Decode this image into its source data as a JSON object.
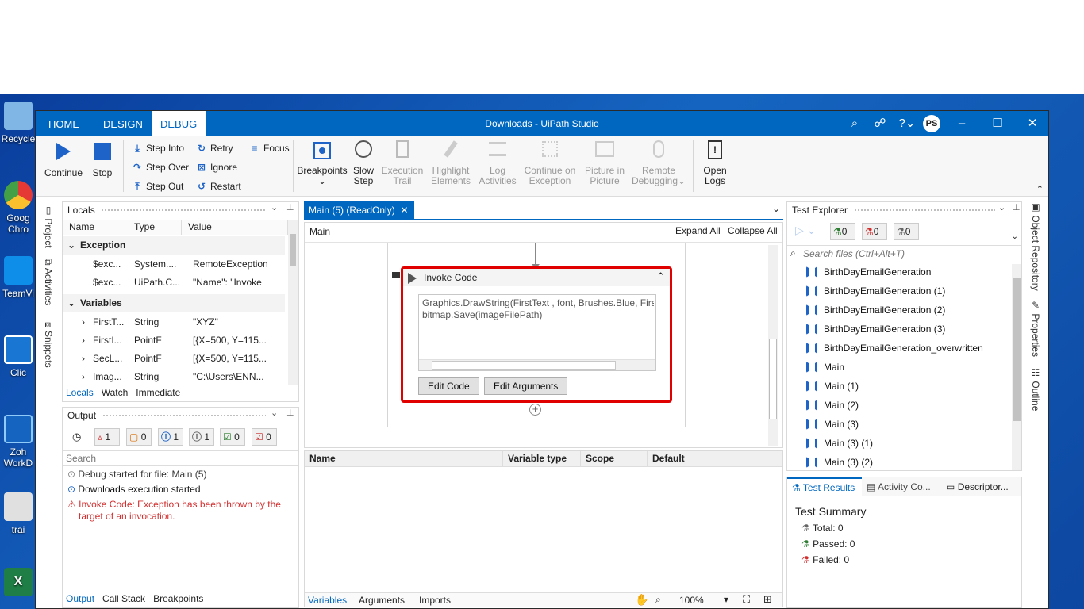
{
  "desktop": {
    "icons": [
      {
        "label": "Recycle",
        "color": "#7fb6e6"
      },
      {
        "label": "Goog Chro",
        "color": "#e53935"
      },
      {
        "label": "TeamVi",
        "color": "#0e8ee9"
      },
      {
        "label": "Clic",
        "color": "#1976d2"
      },
      {
        "label": "Zoh WorkD",
        "color": "#1565c0"
      },
      {
        "label": "trai",
        "color": "#e0e0e0"
      },
      {
        "label": "",
        "color": "#1e7e45"
      }
    ]
  },
  "window": {
    "title": "Downloads - UiPath Studio",
    "avatar": "PS",
    "tabs": [
      {
        "label": "HOME"
      },
      {
        "label": "DESIGN"
      },
      {
        "label": "DEBUG"
      }
    ]
  },
  "ribbon": {
    "continue": "Continue",
    "stop": "Stop",
    "step_into": "Step Into",
    "step_over": "Step Over",
    "step_out": "Step Out",
    "retry": "Retry",
    "ignore": "Ignore",
    "restart": "Restart",
    "focus": "Focus",
    "breakpoints": "Breakpoints",
    "slow_step_1": "Slow",
    "slow_step_2": "Step",
    "exec_trail_1": "Execution",
    "exec_trail_2": "Trail",
    "highlight_1": "Highlight",
    "highlight_2": "Elements",
    "log_1": "Log",
    "log_2": "Activities",
    "cont_exc_1": "Continue on",
    "cont_exc_2": "Exception",
    "pip_1": "Picture in",
    "pip_2": "Picture",
    "remote_1": "Remote",
    "remote_2": "Debugging",
    "open_logs_1": "Open",
    "open_logs_2": "Logs"
  },
  "left_rail": {
    "project": "Project",
    "activities": "Activities",
    "snippets": "Snippets"
  },
  "locals": {
    "title": "Locals",
    "columns": [
      "Name",
      "Type",
      "Value"
    ],
    "groups": {
      "exception": "Exception",
      "variables": "Variables"
    },
    "exception_rows": [
      {
        "name": "$exc...",
        "type": "System....",
        "value": "RemoteException"
      },
      {
        "name": "$exc...",
        "type": "UiPath.C...",
        "value": " \"Name\": \"Invoke"
      }
    ],
    "variable_rows": [
      {
        "name": "FirstT...",
        "type": "String",
        "value": "\"XYZ\""
      },
      {
        "name": "FirstI...",
        "type": "PointF",
        "value": "[{X=500, Y=115..."
      },
      {
        "name": "SecL...",
        "type": "PointF",
        "value": "[{X=500, Y=115..."
      },
      {
        "name": "Imag...",
        "type": "String",
        "value": "\"C:\\Users\\ENN..."
      }
    ],
    "tabs": [
      "Locals",
      "Watch",
      "Immediate"
    ]
  },
  "output": {
    "title": "Output",
    "filters": [
      {
        "count": "1",
        "color": "#d32f2f",
        "glyph": "!"
      },
      {
        "count": "0",
        "color": "#d86b00",
        "glyph": "!"
      },
      {
        "count": "1",
        "color": "#1e64c8",
        "glyph": "i"
      },
      {
        "count": "1",
        "color": "#666666",
        "glyph": "i"
      },
      {
        "count": "0",
        "color": "#2e7d32",
        "glyph": "✓"
      },
      {
        "count": "0",
        "color": "#c62828",
        "glyph": "✓"
      }
    ],
    "search_placeholder": "Search",
    "messages": [
      {
        "text": "Debug started for file: Main (5)",
        "color": "#333333"
      },
      {
        "text": "Downloads execution started",
        "color": "#111111"
      },
      {
        "text": "Invoke Code: Exception has been thrown by the target of an invocation.",
        "color": "#d32f2f"
      }
    ],
    "tabs": [
      "Output",
      "Call Stack",
      "Breakpoints"
    ]
  },
  "designer": {
    "doc_tab": "Main (5) (ReadOnly)",
    "breadcrumb": "Main",
    "expand_all": "Expand All",
    "collapse_all": "Collapse All",
    "activity_title": "Invoke Code",
    "code_line1": "Graphics.DrawString(FirstText , font, Brushes.Blue, FirstLo",
    "code_line2": "bitmap.Save(imageFilePath)",
    "edit_code": "Edit Code",
    "edit_arguments": "Edit Arguments",
    "highlight_color": "#e00000"
  },
  "variables": {
    "columns": [
      "Name",
      "Variable type",
      "Scope",
      "Default"
    ],
    "tabs": [
      "Variables",
      "Arguments",
      "Imports"
    ],
    "zoom": "100%"
  },
  "test_explorer": {
    "title": "Test Explorer",
    "counts": [
      {
        "count": "0",
        "color": "#2e7d32"
      },
      {
        "count": "0",
        "color": "#d32f2f"
      },
      {
        "count": "0",
        "color": "#666666"
      }
    ],
    "search_placeholder": "Search files (Ctrl+Alt+T)",
    "items": [
      "BirthDayEmailGeneration",
      "BirthDayEmailGeneration (1)",
      "BirthDayEmailGeneration (2)",
      "BirthDayEmailGeneration (3)",
      "BirthDayEmailGeneration_overwritten",
      "Main",
      "Main (1)",
      "Main (2)",
      "Main (3)",
      "Main (3) (1)",
      "Main (3) (2)"
    ],
    "bottom_tabs": [
      "Test Results",
      "Activity Co...",
      "Descriptor..."
    ],
    "summary_title": "Test Summary",
    "total": "Total: 0",
    "passed": "Passed: 0",
    "failed": "Failed: 0"
  },
  "right_rail": {
    "object_repository": "Object Repository",
    "properties": "Properties",
    "outline": "Outline"
  }
}
